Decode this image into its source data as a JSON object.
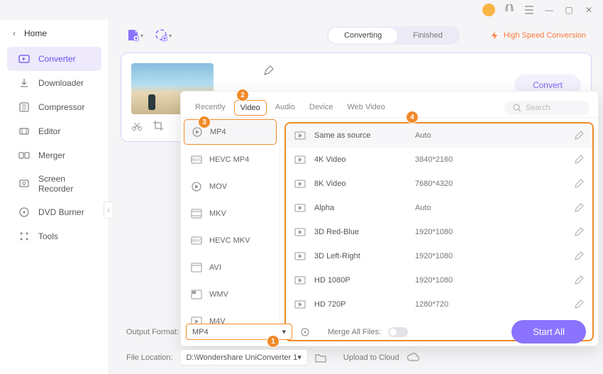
{
  "titlebar": {
    "min": "—",
    "max": "▢",
    "close": "✕"
  },
  "home_label": "Home",
  "sidebar": {
    "items": [
      {
        "label": "Converter",
        "active": true
      },
      {
        "label": "Downloader"
      },
      {
        "label": "Compressor"
      },
      {
        "label": "Editor"
      },
      {
        "label": "Merger"
      },
      {
        "label": "Screen Recorder"
      },
      {
        "label": "DVD Burner"
      },
      {
        "label": "Tools"
      }
    ]
  },
  "toolbar": {
    "segmented": {
      "converting": "Converting",
      "finished": "Finished"
    },
    "speed": "High Speed Conversion"
  },
  "card": {
    "convert_label": "Convert"
  },
  "popup": {
    "tabs": [
      "Recently",
      "Video",
      "Audio",
      "Device",
      "Web Video"
    ],
    "active_tab": "Video",
    "search_placeholder": "Search",
    "formats": [
      "MP4",
      "HEVC MP4",
      "MOV",
      "MKV",
      "HEVC MKV",
      "AVI",
      "WMV",
      "M4V"
    ],
    "active_format": "MP4",
    "presets": [
      {
        "name": "Same as source",
        "res": "Auto"
      },
      {
        "name": "4K Video",
        "res": "3840*2160"
      },
      {
        "name": "8K Video",
        "res": "7680*4320"
      },
      {
        "name": "Alpha",
        "res": "Auto"
      },
      {
        "name": "3D Red-Blue",
        "res": "1920*1080"
      },
      {
        "name": "3D Left-Right",
        "res": "1920*1080"
      },
      {
        "name": "HD 1080P",
        "res": "1920*1080"
      },
      {
        "name": "HD 720P",
        "res": "1280*720"
      }
    ]
  },
  "annotations": {
    "a1": "1",
    "a2": "2",
    "a3": "3",
    "a4": "4"
  },
  "footer": {
    "output_label": "Output Format:",
    "output_value": "MP4",
    "location_label": "File Location:",
    "location_value": "D:\\Wondershare UniConverter 1",
    "merge_label": "Merge All Files:",
    "upload_label": "Upload to Cloud",
    "start_label": "Start All"
  }
}
